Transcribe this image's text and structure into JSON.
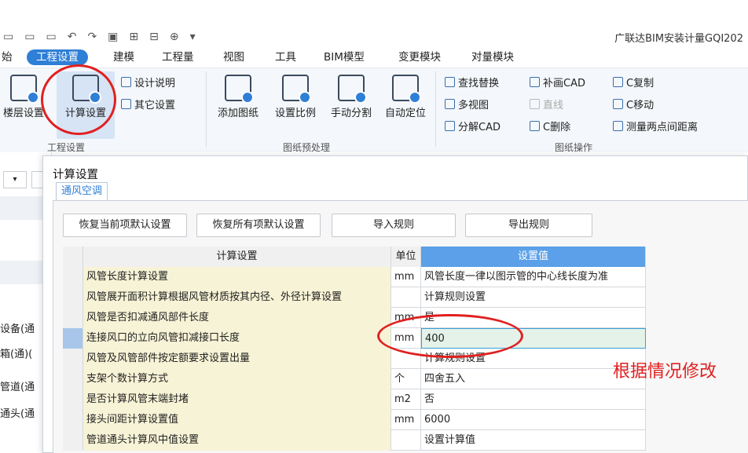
{
  "app": {
    "title_fragment": "广联达BIM安装计量GQI202"
  },
  "menu": {
    "items": [
      "始",
      "工程设置",
      "建模",
      "工程量",
      "视图",
      "工具",
      "BIM模型",
      "变更模块",
      "对量模块"
    ],
    "active": "工程设置"
  },
  "ribbon": {
    "project_settings": {
      "floor_settings": "楼层设置",
      "calc_settings": "计算设置",
      "design_notes": "设计说明",
      "other_settings": "其它设置",
      "group_label": "工程设置"
    },
    "drawing_preprocess": {
      "add_drawing": "添加图纸",
      "set_scale": "设置比例",
      "manual_split": "手动分割",
      "auto_locate": "自动定位",
      "group_label": "图纸预处理"
    },
    "drawing_ops": {
      "find_replace": "查找替换",
      "patch_cad": "补画CAD",
      "c_copy": "C复制",
      "multi_view": "多视图",
      "line": "直线",
      "c_move": "C移动",
      "explode_cad": "分解CAD",
      "c_delete": "C删除",
      "measure_distance": "测量两点间距离",
      "group_label": "图纸操作"
    }
  },
  "left_panel": {
    "items": [
      "设备(通",
      "箱(通)(",
      "管道(通",
      "通头(通"
    ]
  },
  "dialog": {
    "title": "计算设置",
    "tab": "通风空调",
    "buttons": {
      "restore_current": "恢复当前项默认设置",
      "restore_all": "恢复所有项默认设置",
      "import_rules": "导入规则",
      "export_rules": "导出规则"
    },
    "grid": {
      "headers": {
        "name": "计算设置",
        "unit": "单位",
        "value": "设置值"
      },
      "rows": [
        {
          "name": "风管长度计算设置",
          "unit": "mm",
          "value": "风管长度一律以图示管的中心线长度为准"
        },
        {
          "name": "风管展开面积计算根据风管材质按其内径、外径计算设置",
          "unit": "",
          "value": "计算规则设置"
        },
        {
          "name": "风管是否扣减通风部件长度",
          "unit": "mm",
          "value": "是"
        },
        {
          "name": "连接风口的立向风管扣减接口长度",
          "unit": "mm",
          "value": "400"
        },
        {
          "name": "风管及风管部件按定额要求设置出量",
          "unit": "",
          "value": "计算规则设置"
        },
        {
          "name": "支架个数计算方式",
          "unit": "个",
          "value": "四舍五入"
        },
        {
          "name": "是否计算风管末端封堵",
          "unit": "m2",
          "value": "否"
        },
        {
          "name": "接头间距计算设置值",
          "unit": "mm",
          "value": "6000"
        },
        {
          "name": "管道通头计算风中值设置",
          "unit": "",
          "value": "设置计算值"
        }
      ],
      "selected_row": 3
    }
  },
  "annotation": {
    "text": "根据情况修改",
    "color": "#e02020"
  },
  "colors": {
    "accent": "#2f7fd6",
    "header_value_bg": "#5ba0e8",
    "name_col_bg": "#f7f3d6"
  }
}
